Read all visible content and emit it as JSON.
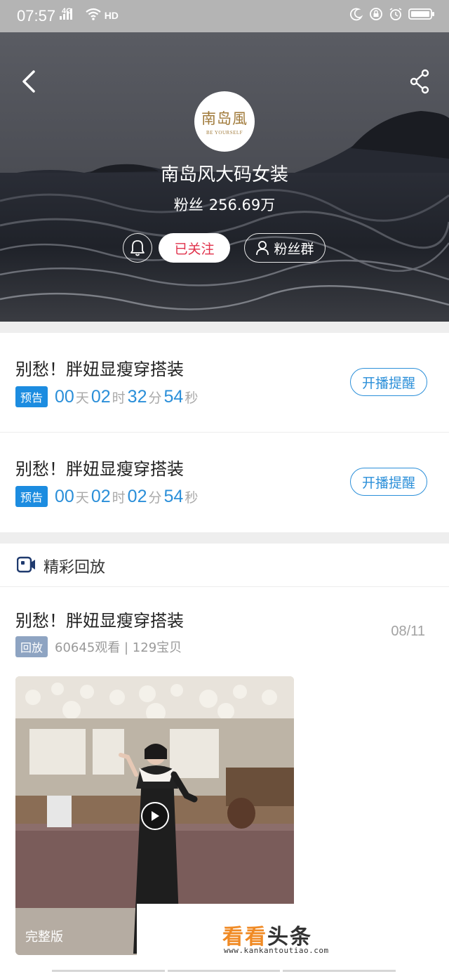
{
  "status_bar": {
    "time": "07:57",
    "network": "4G",
    "hd": "HD",
    "icons": [
      "signal-icon",
      "wifi-icon",
      "moon-icon",
      "lock-icon",
      "alarm-icon",
      "battery-icon"
    ]
  },
  "header": {
    "logo_text": "南岛風",
    "logo_subtext": "BE YOURSELF",
    "shop_name": "南岛风大码女装",
    "fans_label": "粉丝",
    "fans_count": "256.69万",
    "follow_label": "已关注",
    "fan_group_label": "粉丝群",
    "icons": [
      "back-icon",
      "share-icon",
      "bell-icon",
      "user-icon"
    ]
  },
  "upcoming": [
    {
      "title": "别愁！胖妞显瘦穿搭装",
      "tag": "预告",
      "days": "00",
      "day_unit": "天",
      "hours": "02",
      "hour_unit": "时",
      "minutes": "32",
      "minute_unit": "分",
      "seconds": "54",
      "second_unit": "秒",
      "remind_label": "开播提醒"
    },
    {
      "title": "别愁！胖妞显瘦穿搭装",
      "tag": "预告",
      "days": "00",
      "day_unit": "天",
      "hours": "02",
      "hour_unit": "时",
      "minutes": "02",
      "minute_unit": "分",
      "seconds": "54",
      "second_unit": "秒",
      "remind_label": "开播提醒"
    }
  ],
  "replay": {
    "section_label": "精彩回放",
    "items": [
      {
        "title": "别愁！胖妞显瘦穿搭装",
        "tag": "回放",
        "stats": "60645观看 | 129宝贝",
        "date": "08/11",
        "badge": "完整版"
      }
    ]
  },
  "watermark": {
    "part1": "看看",
    "part2": "头条",
    "url": "www.kankantoutiao.com"
  },
  "colors": {
    "accent_blue": "#2b8fd9",
    "follow_red": "#e0314b",
    "replay_tag": "#8ea4c2",
    "watermark_orange": "#f08a24"
  }
}
